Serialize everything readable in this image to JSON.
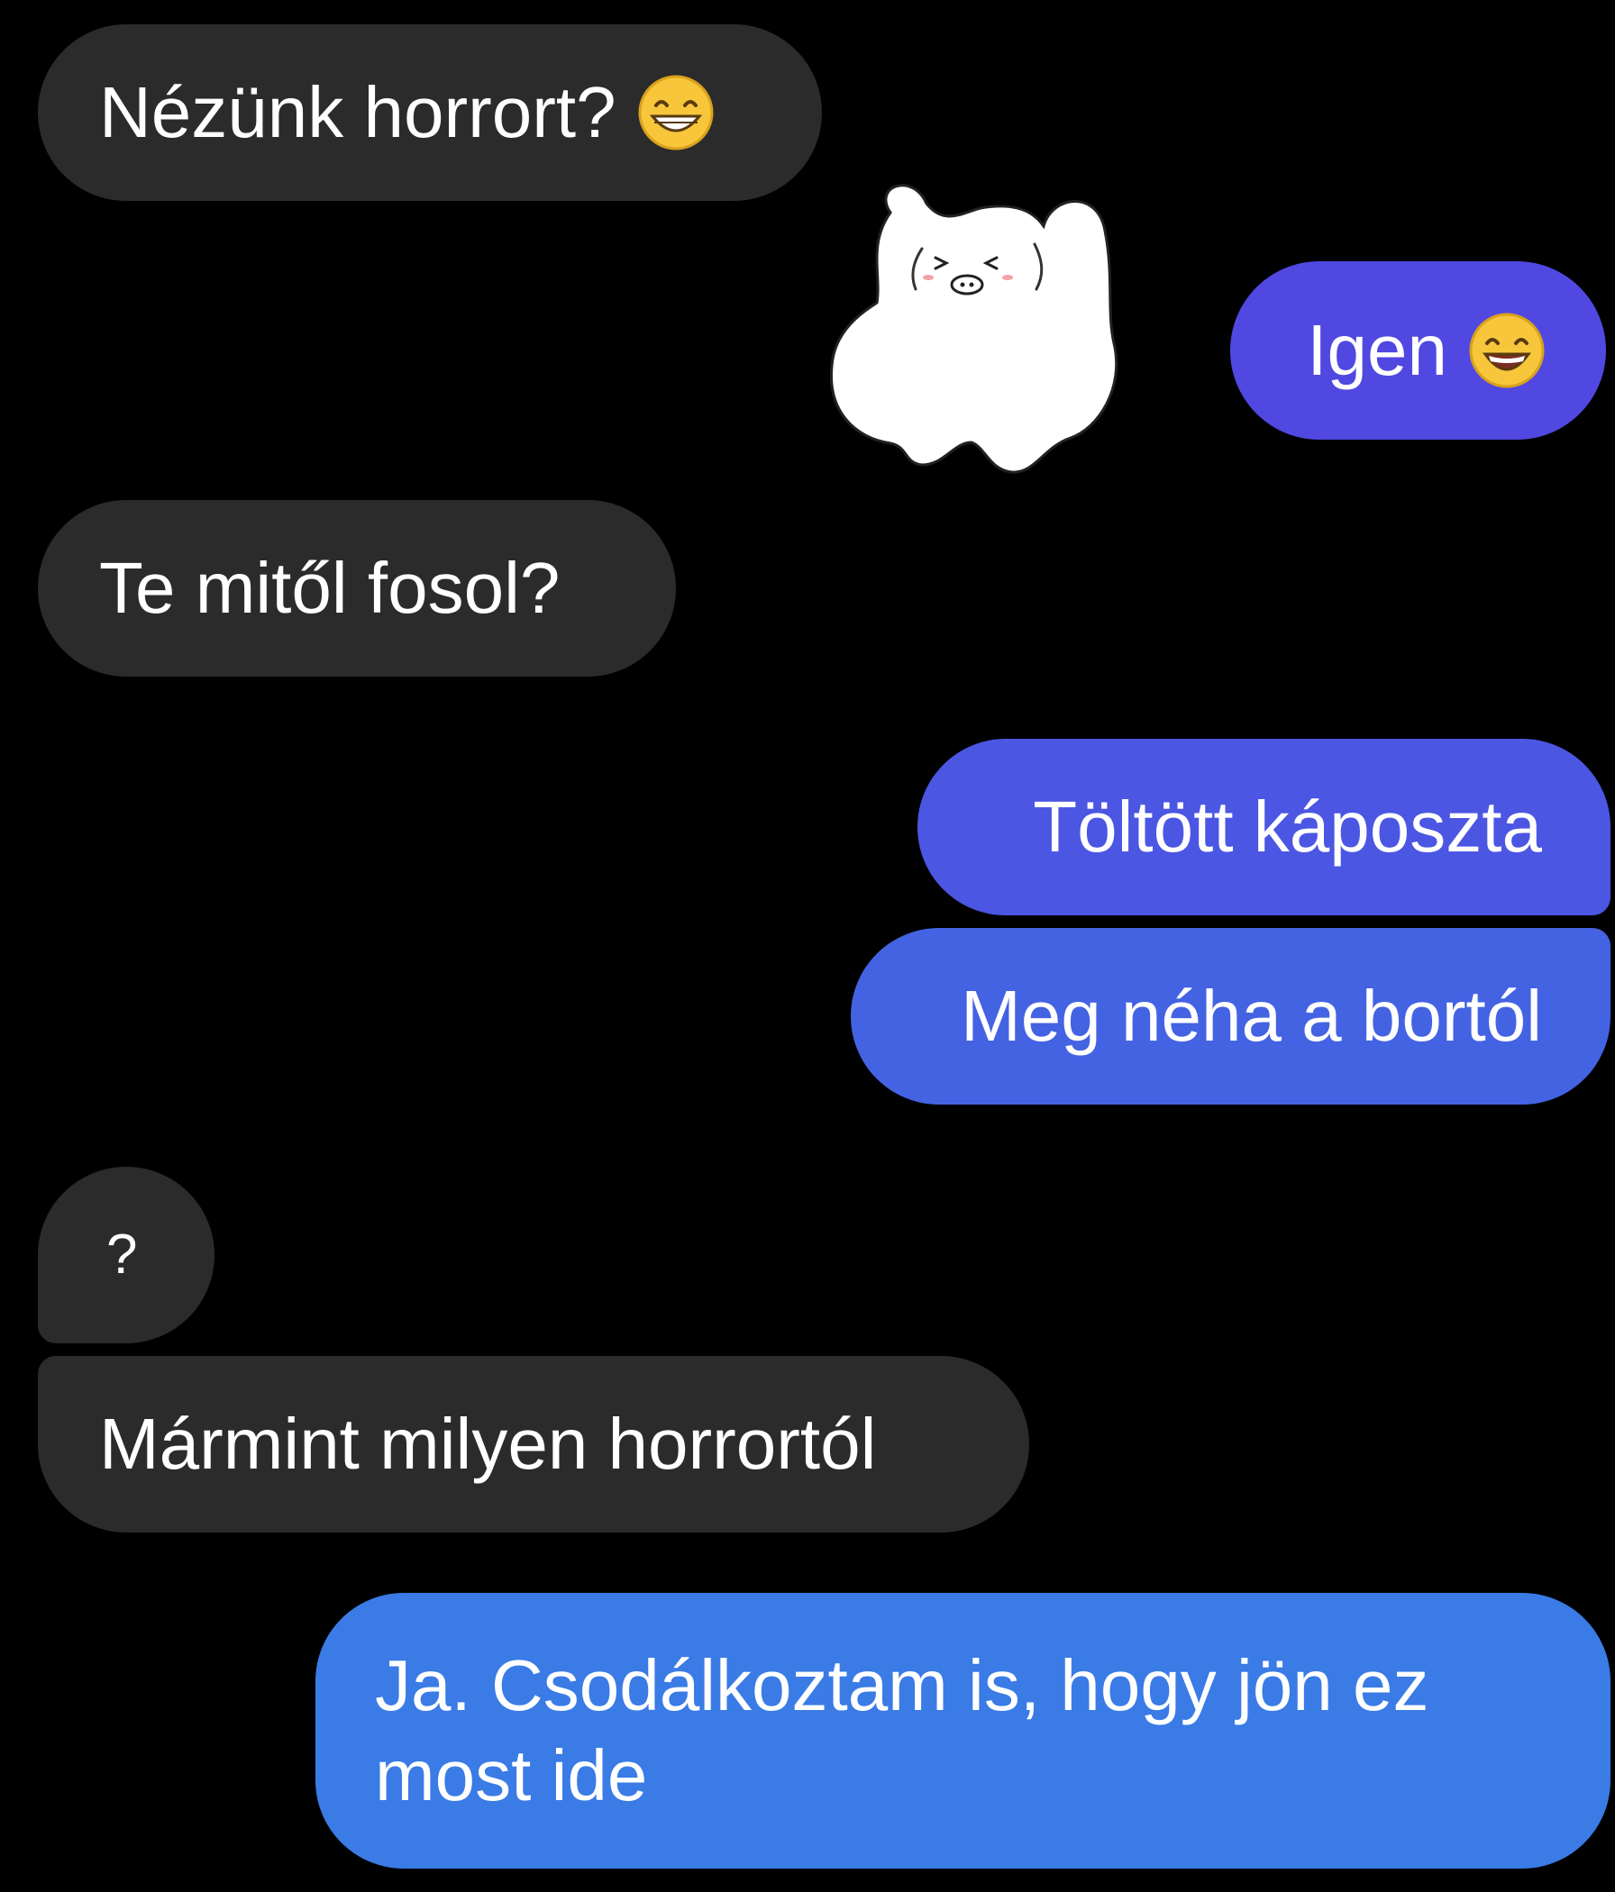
{
  "conversation": {
    "messages": [
      {
        "direction": "incoming",
        "text": "Nézünk horrort?",
        "emoji": "grinning-face-with-smiling-eyes"
      },
      {
        "direction": "outgoing",
        "text": "Igen",
        "emoji": "grinning-face-with-smiling-eyes-open"
      },
      {
        "direction": "incoming",
        "text": "Te mitől fosol?"
      },
      {
        "direction": "outgoing",
        "text": "Töltött káposzta"
      },
      {
        "direction": "outgoing",
        "text": "Meg néha a bortól"
      },
      {
        "direction": "incoming",
        "text": "?"
      },
      {
        "direction": "incoming",
        "text": "Mármint milyen horrortól"
      },
      {
        "direction": "outgoing",
        "text": "Ja. Csodálkoztam is, hogy jön ez most ide"
      }
    ],
    "sticker": {
      "name": "white-bear-sticker"
    }
  },
  "colors": {
    "background": "#000000",
    "incoming_bubble": "#2b2b2b",
    "outgoing_bubble_top": "#5048e0",
    "outgoing_bubble_bottom": "#3a7be6",
    "text": "#ffffff"
  }
}
